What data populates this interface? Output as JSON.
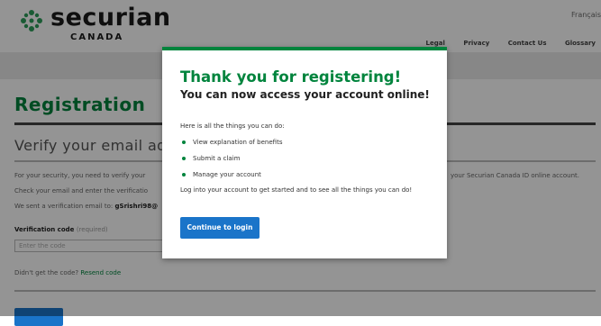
{
  "header": {
    "brand": "securian",
    "brand_sub": "CANADA",
    "language_link": "Français",
    "nav": [
      "Legal",
      "Privacy",
      "Contact Us",
      "Glossary"
    ]
  },
  "page": {
    "title": "Registration",
    "subtitle": "Verify your email addr",
    "para1_left": "For your security, you need to verify your",
    "para1_right": "your Securian Canada ID online account.",
    "para2": "Check your email and enter the verificatio",
    "para3_prefix": "We sent a verification email to:",
    "para3_email": "gSrishri98@",
    "code_label": "Verification code",
    "code_required": "(required)",
    "code_placeholder": "Enter the code",
    "resend_prefix": "Didn't get the code?",
    "resend_link": "Resend code"
  },
  "modal": {
    "title": "Thank you for registering!",
    "subtitle": "You can now access your account online!",
    "intro": "Here is all the things you can do:",
    "items": [
      "View explanation of benefits",
      "Submit a claim",
      "Manage your account"
    ],
    "login_text": "Log into your account to get started and to see all the things you can do!",
    "button_label": "Continue to login"
  },
  "colors": {
    "accent_green": "#00843D",
    "button_blue": "#1a74c9"
  }
}
